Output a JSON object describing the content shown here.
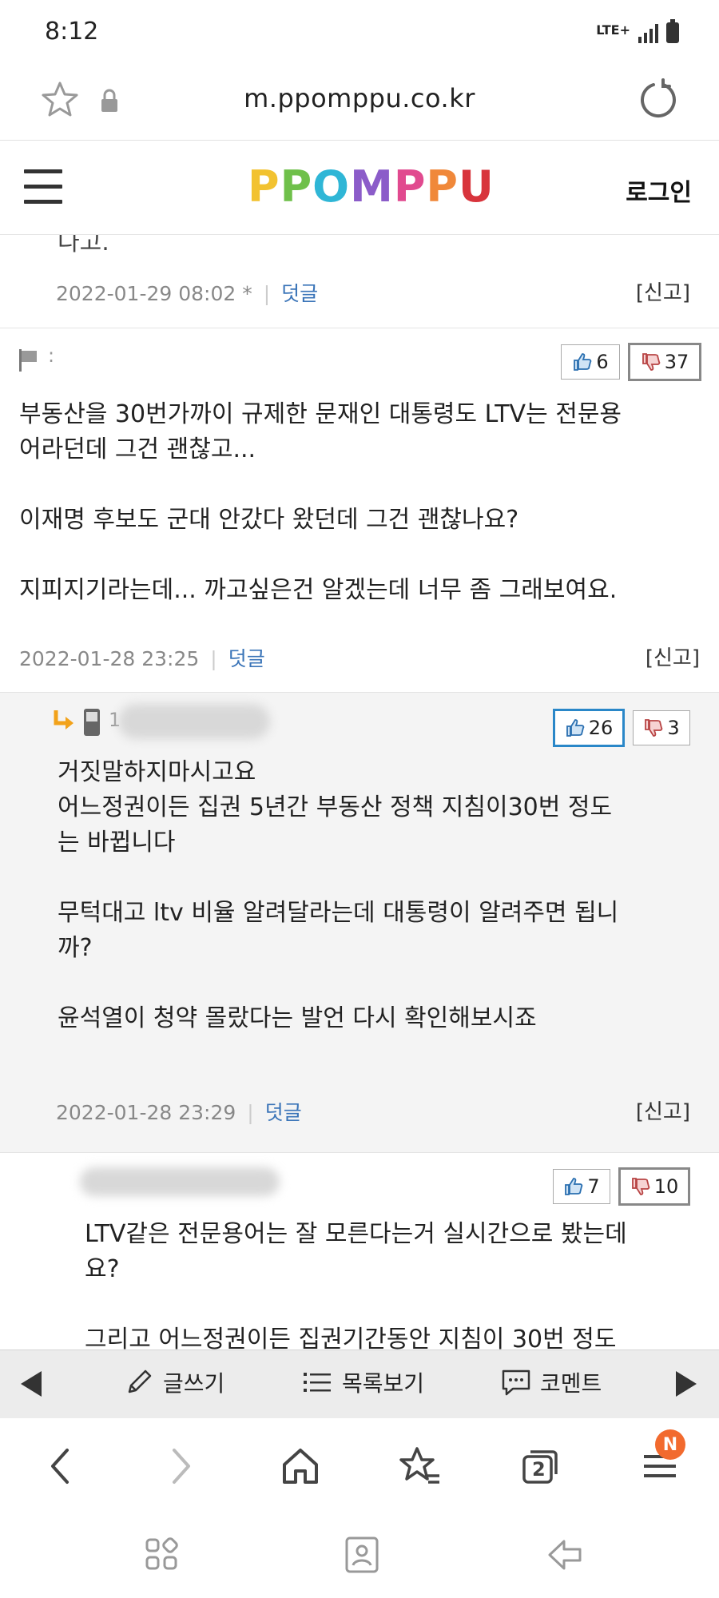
{
  "status": {
    "time": "8:12",
    "network": "LTE+"
  },
  "browser": {
    "url": "m.ppomppu.co.kr",
    "tab_count": "2",
    "menu_badge": "N"
  },
  "header": {
    "logo": "PPOMPPU",
    "login": "로그인"
  },
  "top_comment": {
    "cut_text": "다고.",
    "date": "2022-01-29 08:02 *",
    "reply_label": "덧글",
    "report_label": "[신고]"
  },
  "comments": [
    {
      "author": ":",
      "up": "6",
      "down": "37",
      "text": "부동산을 30번가까이 규제한 문재인 대통령도 LTV는 전문용\n어라던데 그건 괜찮고...\n\n이재명 후보도 군대 안갔다 왔던데 그건 괜찮나요?\n\n지피지기라는데... 까고싶은건 알겠는데 너무 좀 그래보여요.",
      "date": "2022-01-28 23:25",
      "reply_label": "덧글",
      "report_label": "[신고]"
    },
    {
      "author": "1",
      "up": "26",
      "down": "3",
      "text": "거짓말하지마시고요\n어느정권이든 집권 5년간 부동산 정책 지침이30번 정도\n는 바뀝니다\n\n무턱대고 ltv 비율 알려달라는데 대통령이 알려주면 됩니\n까?\n\n윤석열이 청약 몰랐다는 발언 다시 확인해보시죠",
      "date": "2022-01-28 23:29",
      "reply_label": "덧글",
      "report_label": "[신고]"
    },
    {
      "up": "7",
      "down": "10",
      "text": "LTV같은 전문용어는 잘 모른다는거 실시간으로 봤는데\n요?\n\n그리고 어느정권이든 집권기간동안 지침이 30번 정도"
    }
  ],
  "board_nav": {
    "write": "글쓰기",
    "list": "목록보기",
    "comment": "코멘트"
  },
  "colors": {
    "accent_blue": "#2a87c8",
    "badge": "#f26a2e",
    "link": "#3a74b8"
  },
  "icons": [
    "star-icon",
    "lock-icon",
    "reload-icon",
    "menu-icon",
    "thumbs-up-icon",
    "thumbs-down-icon",
    "pencil-icon",
    "list-icon",
    "chat-icon",
    "home-icon",
    "bookmarks-icon",
    "tabs-icon",
    "hamburger-icon",
    "recent-apps-icon",
    "home-square-icon",
    "back-icon"
  ]
}
